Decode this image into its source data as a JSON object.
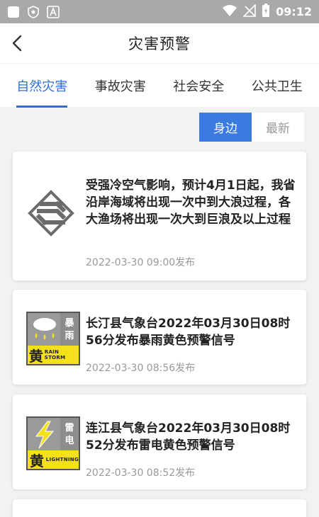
{
  "status_bar": {
    "time": "09:12"
  },
  "header": {
    "title": "灾害预警"
  },
  "tabs": [
    {
      "label": "自然灾害",
      "active": true
    },
    {
      "label": "事故灾害",
      "active": false
    },
    {
      "label": "社会安全",
      "active": false
    },
    {
      "label": "公共卫生",
      "active": false
    }
  ],
  "filter": {
    "nearby": "身边",
    "latest": "最新"
  },
  "cards": [
    {
      "icon": "ocean-bureau-logo-icon",
      "text": "受强冷空气影响，预计4月1日起，我省沿岸海域将出现一次中到大浪过程，各大渔场将出现一次大到巨浪及以上过程",
      "time": "2022-03-30 09:00发布"
    },
    {
      "icon": "rainstorm-yellow-warning-icon",
      "badge_side": [
        "暴",
        "雨"
      ],
      "badge_level": "黄",
      "badge_en": "RAIN STORM",
      "text": "长汀县气象台2022年03月30日08时56分发布暴雨黄色预警信号",
      "time": "2022-03-30 08:56发布"
    },
    {
      "icon": "thunder-yellow-warning-icon",
      "badge_side": [
        "雷",
        "电"
      ],
      "badge_level": "黄",
      "badge_en": "LIGHTNING",
      "text": "连江县气象台2022年03月30日08时52分发布雷电黄色预警信号",
      "time": "2022-03-30 08:52发布"
    }
  ],
  "colors": {
    "accent": "#3b7be0",
    "status_bar": "#a9a9a9",
    "warning_yellow": "#f5e11a"
  }
}
